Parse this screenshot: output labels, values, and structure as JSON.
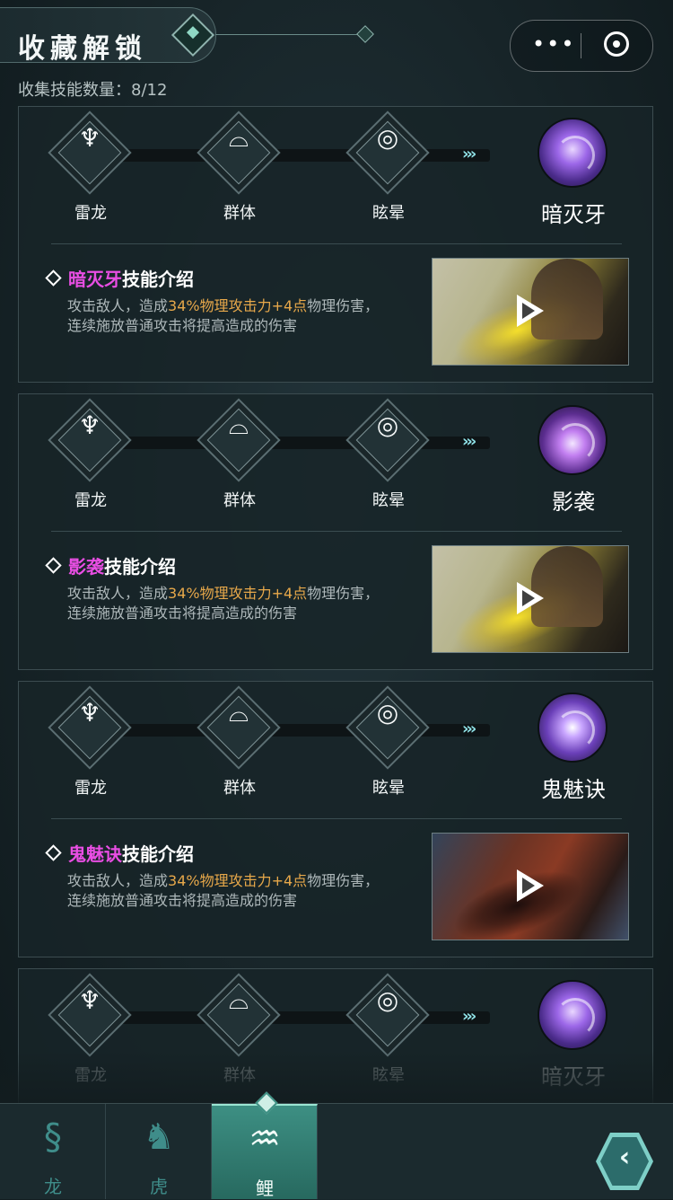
{
  "header": {
    "title": "收藏解锁",
    "menu_dots": "•••",
    "count_text": "收集技能数量：8/12"
  },
  "nodes": [
    {
      "label": "雷龙",
      "icon": "dragon-emblem-icon",
      "glyph": "♆"
    },
    {
      "label": "群体",
      "icon": "group-arc-icon",
      "glyph": "⌓"
    },
    {
      "label": "眩晕",
      "icon": "swirl-icon",
      "glyph": "◎"
    }
  ],
  "track_arrows": "›››",
  "cards": [
    {
      "skill": "暗灭牙",
      "intro_suffix": "技能介绍",
      "desc_prefix": "攻击敌人，造成",
      "desc_highlight": "34%物理攻击力+4点",
      "desc_suffix": "物理伤害，",
      "desc_line2": "连续施放普通攻击将提高造成的伤害"
    },
    {
      "skill": "影袭",
      "intro_suffix": "技能介绍",
      "desc_prefix": "攻击敌人，造成",
      "desc_highlight": "34%物理攻击力+4点",
      "desc_suffix": "物理伤害，",
      "desc_line2": "连续施放普通攻击将提高造成的伤害"
    },
    {
      "skill": "鬼魅诀",
      "intro_suffix": "技能介绍",
      "desc_prefix": "攻击敌人，造成",
      "desc_highlight": "34%物理攻击力+4点",
      "desc_suffix": "物理伤害，",
      "desc_line2": "连续施放普通攻击将提高造成的伤害"
    },
    {
      "skill": "暗灭牙"
    }
  ],
  "tabs": [
    {
      "label": "龙",
      "icon": "dragon-icon",
      "glyph": "§"
    },
    {
      "label": "虎",
      "icon": "tiger-icon",
      "glyph": "♞"
    },
    {
      "label": "鲤",
      "icon": "carp-icon",
      "glyph": "♒"
    }
  ],
  "back_glyph": "‹",
  "colors": {
    "accent_teal": "#3d8f83",
    "highlight_pink": "#e94ee4",
    "highlight_gold": "#e7a84a"
  }
}
